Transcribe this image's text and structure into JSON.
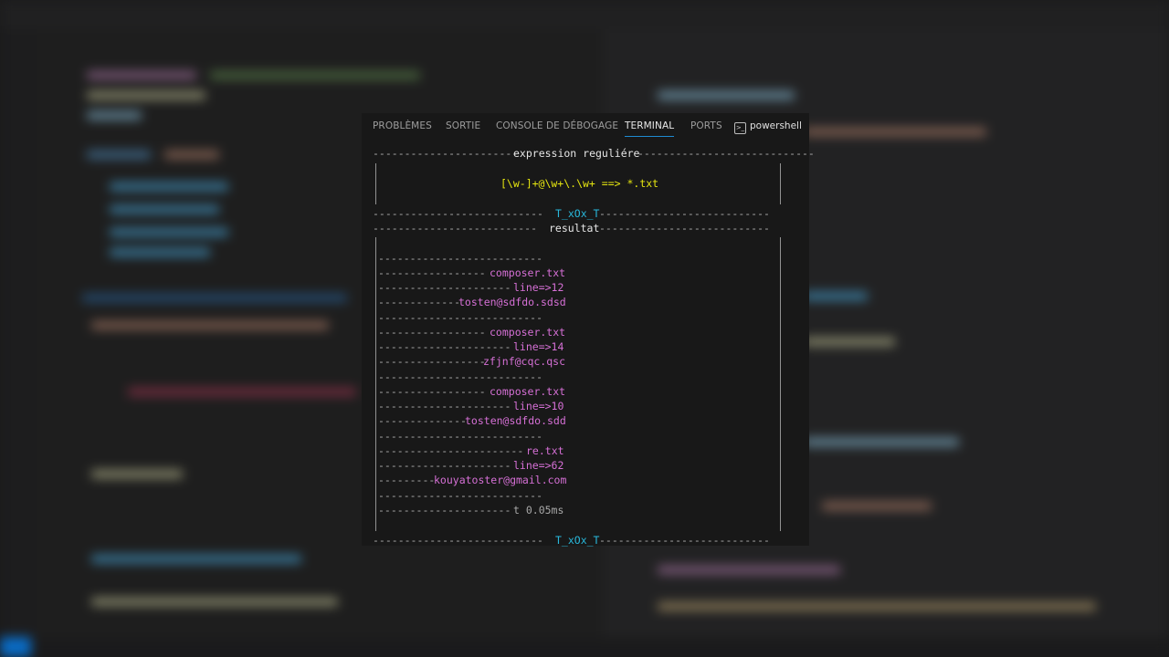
{
  "tabs": [
    {
      "label": "PROBLÈMES"
    },
    {
      "label": "SORTIE"
    },
    {
      "label": "CONSOLE DE DÉBOGAGE"
    },
    {
      "label": "TERMINAL",
      "active": true
    },
    {
      "label": "PORTS"
    }
  ],
  "shell": {
    "icon": "powershell-icon",
    "label": "powershell"
  },
  "output": {
    "header_title": "expression reguliére",
    "regex": "[\\w-]+@\\w+\\.\\w+ ==> *.txt",
    "signature": "T_xOx_T",
    "results_title": "resultat",
    "results": [
      {
        "file": "composer.txt",
        "line": "line=>12",
        "email": "tosten@sdfdo.sdsd"
      },
      {
        "file": "composer.txt",
        "line": "line=>14",
        "email": "zfjnf@cqc.qsc"
      },
      {
        "file": "composer.txt",
        "line": "line=>10",
        "email": "tosten@sdfdo.sdd"
      },
      {
        "file": "re.txt",
        "line": "line=>62",
        "email": "kouyatoster@gmail.com"
      }
    ],
    "timing": "t 0.05ms"
  },
  "colors": {
    "panel_bg": "#181818",
    "regex": "#e5e510",
    "signature": "#29b8db",
    "result": "#d670d6",
    "tab_active_underline": "#1f8ad2"
  }
}
